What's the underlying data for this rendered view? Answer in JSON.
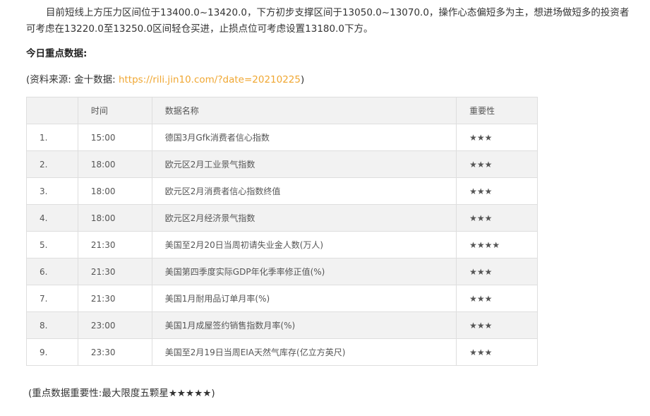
{
  "article": {
    "paragraph": "目前短线上方压力区间位于13400.0~13420.0，下方初步支撑区间于13050.0~13070.0，操作心态偏短多为主，想进场做短多的投资者可考虑在13220.0至13250.0区间轻仓买进，止损点位可考虑设置13180.0下方。",
    "heading": "今日重点数据:",
    "source_prefix": "(资料来源: 金十数据: ",
    "source_link": "https://rili.jin10.com/?date=20210225",
    "source_suffix": ")",
    "note": "(重点数据重要性:最大限度五颗星★★★★★)"
  },
  "table": {
    "headers": [
      "",
      "时间",
      "数据名称",
      "重要性"
    ],
    "rows": [
      {
        "idx": "1.",
        "time": "15:00",
        "name": "德国3月Gfk消费者信心指数",
        "importance": "★★★"
      },
      {
        "idx": "2.",
        "time": "18:00",
        "name": "欧元区2月工业景气指数",
        "importance": "★★★"
      },
      {
        "idx": "3.",
        "time": "18:00",
        "name": "欧元区2月消费者信心指数终值",
        "importance": "★★★"
      },
      {
        "idx": "4.",
        "time": "18:00",
        "name": "欧元区2月经济景气指数",
        "importance": "★★★"
      },
      {
        "idx": "5.",
        "time": "21:30",
        "name": "美国至2月20日当周初请失业金人数(万人)",
        "importance": "★★★★"
      },
      {
        "idx": "6.",
        "time": "21:30",
        "name": "美国第四季度实际GDP年化季率修正值(%)",
        "importance": "★★★"
      },
      {
        "idx": "7.",
        "time": "21:30",
        "name": "美国1月耐用品订单月率(%)",
        "importance": "★★★"
      },
      {
        "idx": "8.",
        "time": "23:00",
        "name": "美国1月成屋签约销售指数月率(%)",
        "importance": "★★★"
      },
      {
        "idx": "9.",
        "time": "23:30",
        "name": "美国至2月19日当周EIA天然气库存(亿立方英尺)",
        "importance": "★★★"
      }
    ]
  },
  "colors": {
    "link": "#f0a732",
    "text": "#333333",
    "row_alt": "#f2f2f2",
    "border": "#dedede"
  }
}
